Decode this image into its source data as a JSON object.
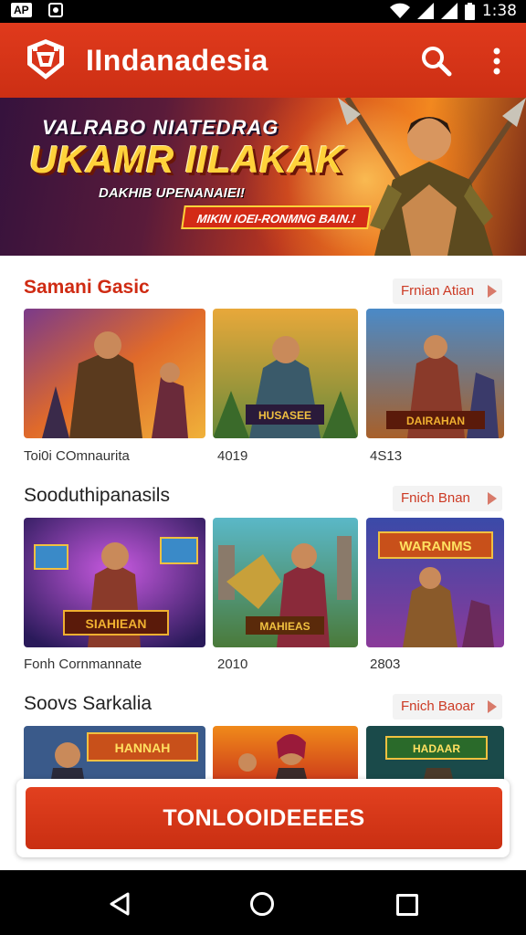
{
  "status_bar": {
    "time": "1:38",
    "badge": "AP",
    "icons": [
      "notification-icon",
      "camera-icon",
      "wifi-icon",
      "signal-icon",
      "signal-icon",
      "battery-icon"
    ]
  },
  "app_bar": {
    "title": "IIndanadesia",
    "icons": [
      "app-logo-icon",
      "search-icon",
      "more-vert-icon"
    ],
    "accent_color": "#d8341a"
  },
  "hero": {
    "line1": "VALRABO NIATEDRAG",
    "line2": "UKAMR IILAKAK",
    "line3": "DAKHIB UPENANAIEI!",
    "ribbon": "MIKIN IOEI-RONMNG BAIN.!"
  },
  "sections": [
    {
      "title": "Samani Gasic",
      "see_all": "Frnian Atian",
      "cards": [
        {
          "caption": "Toi0i COmnaurita",
          "art_text": ""
        },
        {
          "caption": "4019",
          "art_text": "HUSASEE"
        },
        {
          "caption": "4S13",
          "art_text": "DAIRAHAN"
        }
      ]
    },
    {
      "title": "Sooduthipanasils",
      "see_all": "Fnich Bnan",
      "cards": [
        {
          "caption": "Fonh Cornmannate",
          "art_text": "SIAHIEAN"
        },
        {
          "caption": "2010",
          "art_text": "MAHIEAS"
        },
        {
          "caption": "2803",
          "art_text": "WARANMS"
        }
      ]
    },
    {
      "title": "Soovs Sarkalia",
      "see_all": "Fnich Baoar",
      "cards": [
        {
          "caption": "",
          "art_text": "HANNAH"
        },
        {
          "caption": "",
          "art_text": ""
        },
        {
          "caption": "",
          "art_text": "HADAAR"
        }
      ]
    }
  ],
  "download_button": {
    "label": "TONLOOIDEEEES"
  },
  "nav_bar": {
    "icons": [
      "back-icon",
      "home-icon",
      "recents-icon"
    ]
  }
}
